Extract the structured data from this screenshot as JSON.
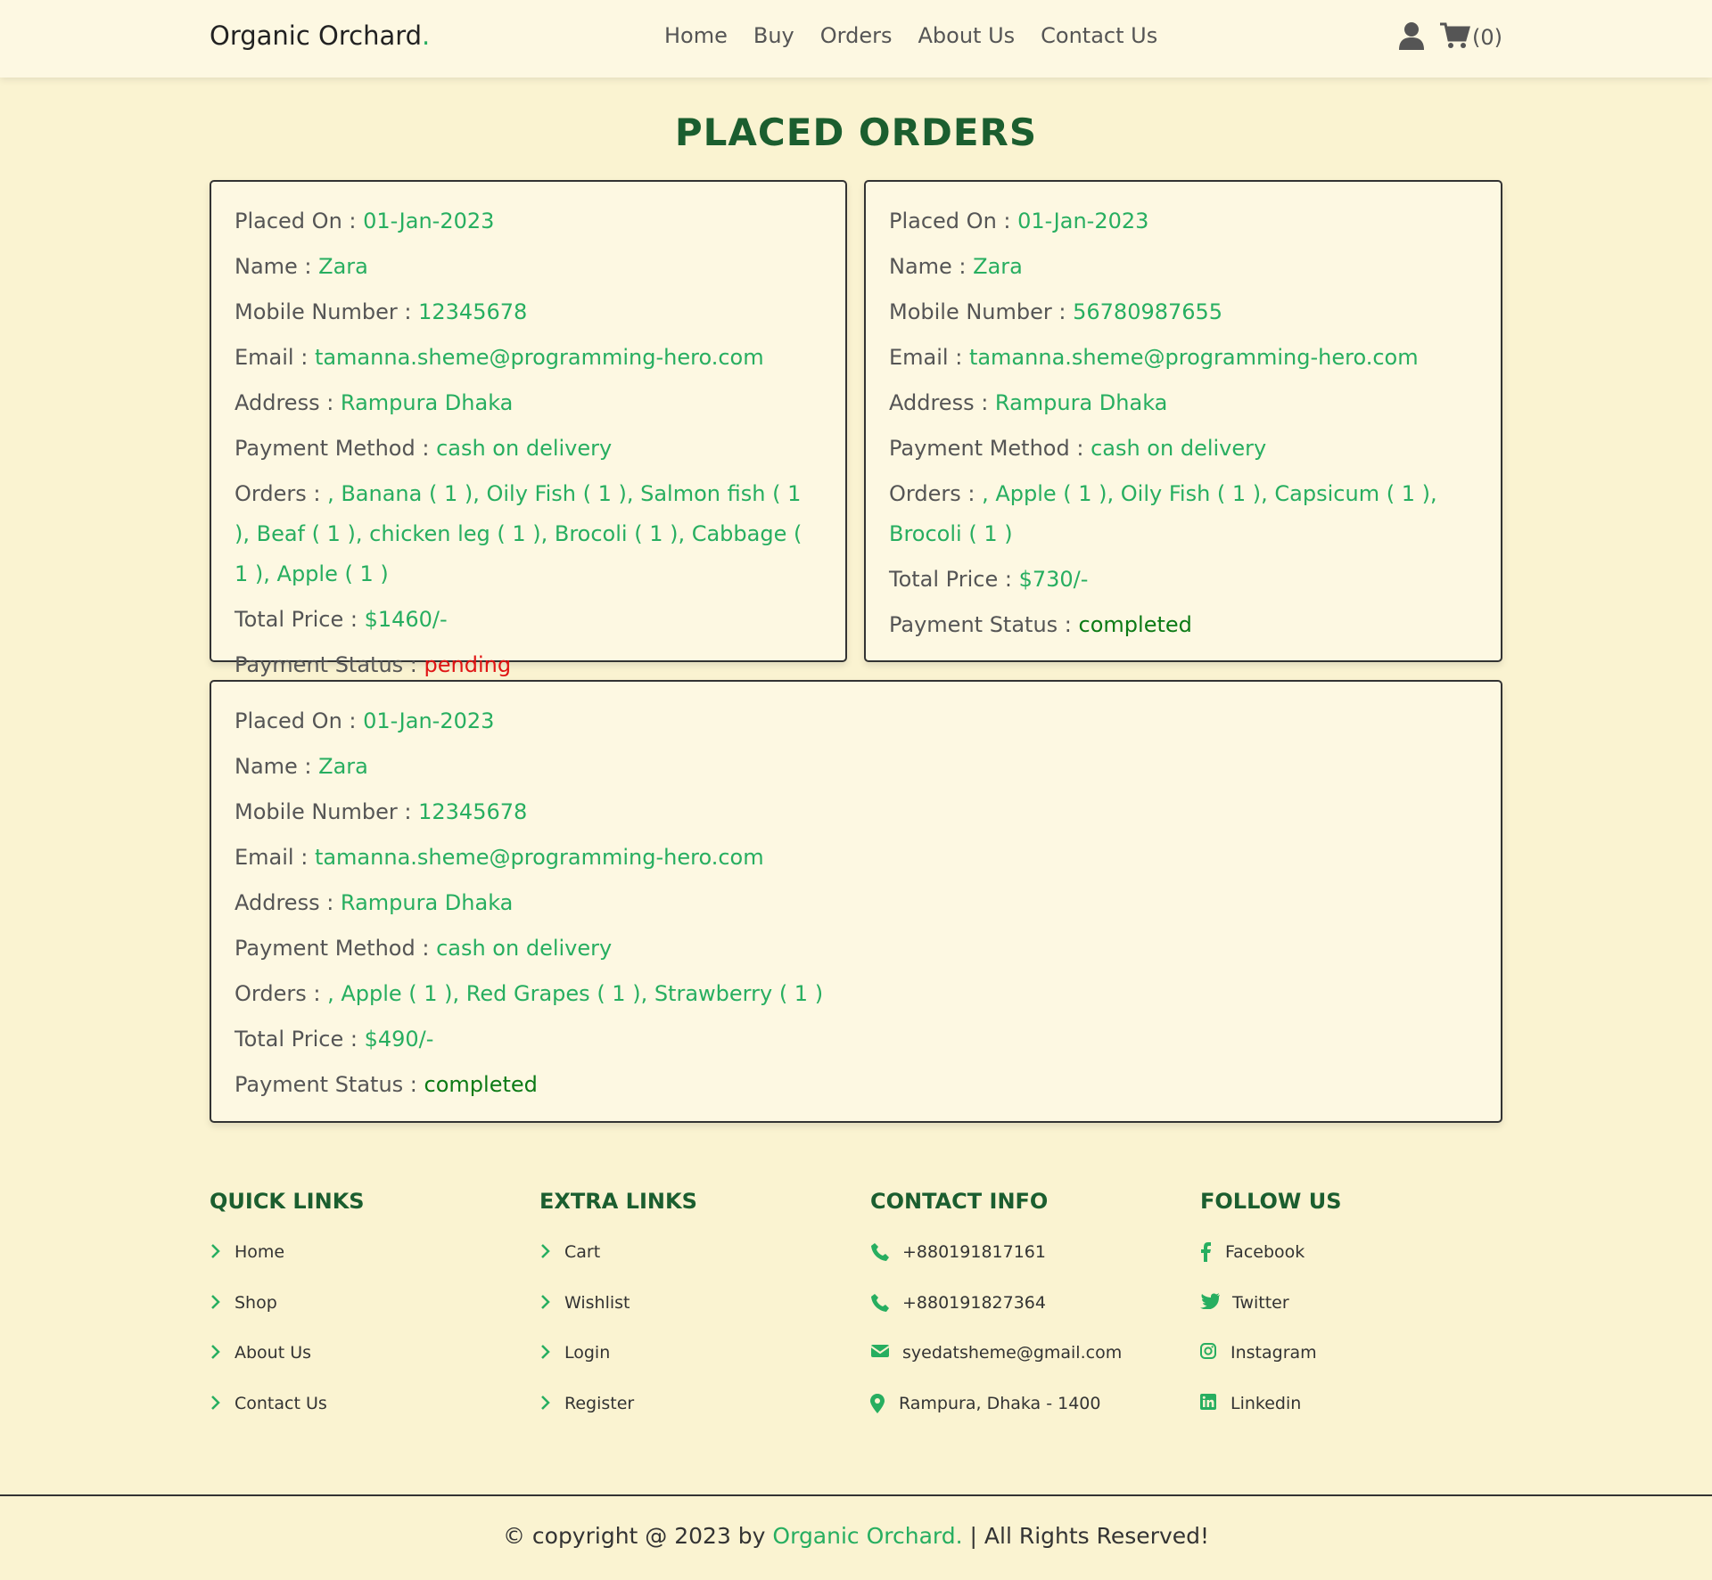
{
  "header": {
    "logo": "Organic Orchard",
    "logo_dot": ".",
    "nav": [
      "Home",
      "Buy",
      "Orders",
      "About Us",
      "Contact Us"
    ],
    "cart_count": "(0)"
  },
  "page_title": "PLACED ORDERS",
  "labels": {
    "placed_on": "Placed On : ",
    "name": "Name : ",
    "mobile": "Mobile Number : ",
    "email": "Email : ",
    "address": "Address : ",
    "payment_method": "Payment Method : ",
    "orders": "Orders : ",
    "total_price": "Total Price : ",
    "payment_status": "Payment Status : "
  },
  "orders": [
    {
      "placed_on": "01-Jan-2023",
      "name": "Zara",
      "mobile": "12345678",
      "email": "tamanna.sheme@programming-hero.com",
      "address": "Rampura Dhaka",
      "payment_method": "cash on delivery",
      "items": ", Banana ( 1 ), Oily Fish ( 1 ), Salmon fish ( 1 ), Beaf ( 1 ), chicken leg ( 1 ), Brocoli ( 1 ), Cabbage ( 1 ), Apple ( 1 )",
      "total_price": "$1460/-",
      "payment_status": "pending"
    },
    {
      "placed_on": "01-Jan-2023",
      "name": "Zara",
      "mobile": "56780987655",
      "email": "tamanna.sheme@programming-hero.com",
      "address": "Rampura Dhaka",
      "payment_method": "cash on delivery",
      "items": ", Apple ( 1 ), Oily Fish ( 1 ), Capsicum ( 1 ), Brocoli ( 1 )",
      "total_price": "$730/-",
      "payment_status": "completed"
    },
    {
      "placed_on": "01-Jan-2023",
      "name": "Zara",
      "mobile": "12345678",
      "email": "tamanna.sheme@programming-hero.com",
      "address": "Rampura Dhaka",
      "payment_method": "cash on delivery",
      "items": ", Apple ( 1 ), Red Grapes ( 1 ), Strawberry ( 1 )",
      "total_price": "$490/-",
      "payment_status": "completed"
    }
  ],
  "footer": {
    "quick_links": {
      "title": "QUICK LINKS",
      "items": [
        "Home",
        "Shop",
        "About Us",
        "Contact Us"
      ]
    },
    "extra_links": {
      "title": "EXTRA LINKS",
      "items": [
        "Cart",
        "Wishlist",
        "Login",
        "Register"
      ]
    },
    "contact_info": {
      "title": "CONTACT INFO",
      "items": [
        "+880191817161",
        "+880191827364",
        "syedatsheme@gmail.com",
        "Rampura, Dhaka - 1400"
      ]
    },
    "follow_us": {
      "title": "FOLLOW US",
      "items": [
        "Facebook",
        "Twitter",
        "Instagram",
        "Linkedin"
      ]
    },
    "copyright_prefix": "© copyright @ 2023 by ",
    "copyright_brand": "Organic Orchard.",
    "copyright_suffix": " | All Rights Reserved!"
  },
  "icons": {
    "header": [
      "user-icon",
      "cart-icon"
    ],
    "link": "chevron-right-icon",
    "contact": [
      "phone-icon",
      "phone-icon",
      "envelope-icon",
      "map-pin-icon"
    ],
    "social": [
      "facebook-icon",
      "twitter-icon",
      "instagram-icon",
      "linkedin-icon"
    ]
  },
  "colors": {
    "accent": "#27ae60",
    "title": "#1b5e2f",
    "pending": "#e01414",
    "completed": "#0b7a15",
    "background": "#faf3d1"
  }
}
